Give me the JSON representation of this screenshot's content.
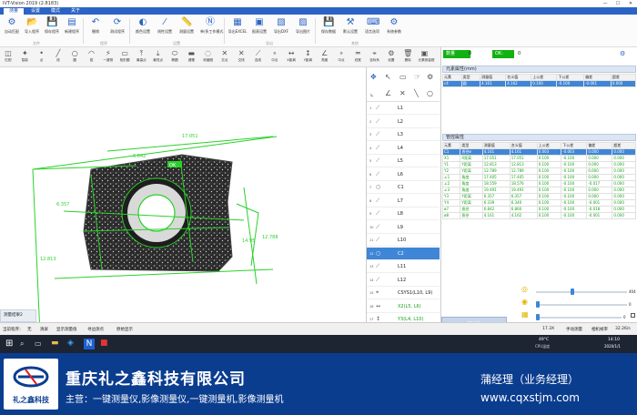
{
  "window": {
    "title": "IVT-Vision 2019  (2.8183)",
    "controls": [
      "—",
      "☐",
      "✕"
    ]
  },
  "tabs": [
    "测量",
    "设置",
    "模式",
    "关于"
  ],
  "ribbon": {
    "buttons": [
      "自动匹配",
      "导入程序",
      "保存程序",
      "新建程序",
      "撤销",
      "测试程序",
      "颜色设置",
      "线性设置",
      "测量设置",
      "单/多工作模式",
      "导出EXCEL",
      "报表设置",
      "导出DXF",
      "导出图片",
      "保存数据",
      "默认设置",
      "语言选项",
      "系统参数"
    ],
    "groups": [
      "文件",
      "程序",
      "设置",
      "导出",
      "其他"
    ]
  },
  "toolbar": {
    "buttons": [
      "匹配",
      "智能",
      "点",
      "线",
      "圆",
      "弧",
      "一键测",
      "矩形圆",
      "最高点",
      "最低点",
      "椭圆",
      "键槽",
      "收缩圈",
      "交点",
      "交线",
      "连线",
      "中点",
      "X距离",
      "Y距离",
      "角度",
      "中点",
      "线宽",
      "坐标系",
      "设置",
      "删除",
      "元素测量框"
    ]
  },
  "viewer": {
    "dimensions": [
      "17.051",
      "6.842",
      "6.357",
      "12.813",
      "12.788",
      "14.95",
      "OK"
    ]
  },
  "feature_list": {
    "items": [
      {
        "num": "1",
        "label": "L1"
      },
      {
        "num": "2",
        "label": "L2"
      },
      {
        "num": "3",
        "label": "L3"
      },
      {
        "num": "4",
        "label": "L4"
      },
      {
        "num": "5",
        "label": "L5"
      },
      {
        "num": "6",
        "label": "L6"
      },
      {
        "num": "7",
        "label": "C1"
      },
      {
        "num": "8",
        "label": "L7"
      },
      {
        "num": "9",
        "label": "L8"
      },
      {
        "num": "10",
        "label": "L9"
      },
      {
        "num": "11",
        "label": "L10"
      },
      {
        "num": "12",
        "label": "C2"
      },
      {
        "num": "13",
        "label": "L11"
      },
      {
        "num": "14",
        "label": "L12"
      },
      {
        "num": "15",
        "label": "CSYS1(L10, L9)"
      },
      {
        "num": "16",
        "label": "X2(L5, L6)"
      },
      {
        "num": "17",
        "label": "Y3(L4, L10)"
      }
    ]
  },
  "status": {
    "counter_label": "数量",
    "counter_value": "0",
    "ok_label": "OK:",
    "ok_value": "0",
    "measure_button": "测量",
    "bottom_tab": "测量结果2"
  },
  "element_props": {
    "title": "元素属性(mm)",
    "headers": [
      "元素",
      "类型",
      "测量值",
      "名义值",
      "上公差",
      "下公差",
      "偏差",
      "超差"
    ],
    "rows": [
      [
        "c4",
        "圆",
        "4.161",
        "4.162",
        "0.100",
        "-0.100",
        "-0.001",
        "0.000"
      ]
    ]
  },
  "measure_props": {
    "title": "管控属性",
    "headers": [
      "元素",
      "类型",
      "测量值",
      "名义值",
      "上公差",
      "下公差",
      "偏差",
      "超差"
    ],
    "rows": [
      [
        "C1",
        "直径ø",
        "4.161",
        "4.161",
        "0.003",
        "-0.003",
        "0.000",
        "0.000"
      ],
      [
        "X1",
        "X距离",
        "17.051",
        "17.051",
        "0.100",
        "-0.100",
        "0.000",
        "0.000"
      ],
      [
        "Y1",
        "Y距离",
        "12.813",
        "12.813",
        "0.100",
        "-0.100",
        "0.000",
        "0.000"
      ],
      [
        "Y2",
        "Y距离",
        "12.789",
        "12.789",
        "0.100",
        "-0.100",
        "0.000",
        "0.000"
      ],
      [
        "∠1",
        "角度",
        "17.405",
        "17.405",
        "0.100",
        "-0.100",
        "0.000",
        "0.000"
      ],
      [
        "∠2",
        "角度",
        "18.559",
        "18.576",
        "0.100",
        "-0.100",
        "-0.017",
        "0.000"
      ],
      [
        "∠3",
        "角度",
        "19.491",
        "19.491",
        "0.100",
        "-0.100",
        "0.000",
        "0.000"
      ],
      [
        "Y3",
        "Y距离",
        "6.357",
        "6.357",
        "0.100",
        "-0.100",
        "0.000",
        "0.000"
      ],
      [
        "Y4",
        "Y距离",
        "6.339",
        "6.340",
        "0.100",
        "-0.100",
        "-0.001",
        "0.000"
      ],
      [
        "ø7",
        "直径",
        "6.842",
        "6.860",
        "0.100",
        "-0.100",
        "-0.018",
        "0.000"
      ],
      [
        "ø8",
        "直径",
        "4.161",
        "4.162",
        "0.100",
        "-0.100",
        "-0.001",
        "0.000"
      ]
    ]
  },
  "lighting": {
    "value1": "404",
    "value2": "0",
    "value3": "0"
  },
  "statusbar": {
    "left": [
      "当前程序：",
      "无",
      "清屏",
      "显示测量值",
      "寻边测点",
      "原始显示"
    ],
    "right": [
      "17.3X",
      "手动测量",
      "相机帧率",
      "32.26/s"
    ]
  },
  "taskbar": {
    "weather": "49°C",
    "weather_sub": "CPU温度",
    "time": "14:10",
    "date": "2020/1/1"
  },
  "banner": {
    "logo_text": "礼之鑫科技",
    "company": "重庆礼之鑫科技有限公司",
    "tagline": "主营：一键测量仪,影像测量仪,一键测量机,影像测量机",
    "contact": "蒲经理（业务经理）",
    "website": "www.cqxstjm.com",
    "colors": {
      "banner_bg": "#0b3d8f",
      "accent": "#2b64c4",
      "ok_green": "#11b111"
    }
  }
}
